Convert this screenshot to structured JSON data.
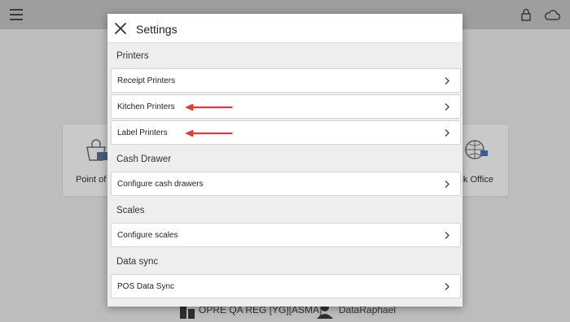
{
  "background": {
    "tiles": [
      {
        "label": "Point of S"
      },
      {
        "label": "ck Office"
      }
    ],
    "footer": {
      "store": "OPRE QA REG [YG][ASMA]",
      "user": "DataRaphael"
    }
  },
  "modal": {
    "title": "Settings",
    "sections": [
      {
        "label": "Printers",
        "rows": [
          {
            "label": "Receipt Printers"
          },
          {
            "label": "Kitchen Printers"
          },
          {
            "label": "Label Printers"
          }
        ]
      },
      {
        "label": "Cash Drawer",
        "rows": [
          {
            "label": "Configure cash drawers"
          }
        ]
      },
      {
        "label": "Scales",
        "rows": [
          {
            "label": "Configure scales"
          }
        ]
      },
      {
        "label": "Data sync",
        "rows": [
          {
            "label": "POS Data Sync"
          }
        ]
      }
    ]
  },
  "annotations": {
    "arrow_color": "#e53935"
  },
  "icons": [
    "hamburger-icon",
    "lock-icon",
    "cloud-icon",
    "close-icon",
    "chevron-right-icon",
    "store-icon",
    "user-icon"
  ]
}
